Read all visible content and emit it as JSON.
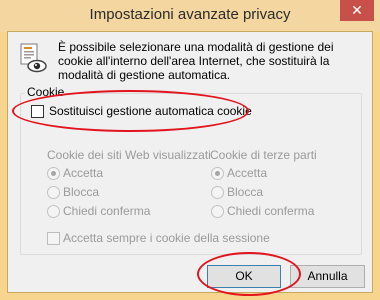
{
  "window": {
    "title": "Impostazioni avanzate privacy",
    "close_glyph": "✕",
    "close_icon": "close-icon",
    "info_icon": "privacy-document-eye-icon"
  },
  "info_text": "È possibile selezionare una modalità di gestione dei cookie all'interno dell'area Internet, che sostituirà la modalità di gestione automatica.",
  "cookie_group": {
    "legend": "Cookie",
    "override_label": "Sostituisci gestione automatica cookie",
    "override_checked": false,
    "first_party": {
      "header": "Cookie dei siti Web visualizzati",
      "options": [
        "Accetta",
        "Blocca",
        "Chiedi conferma"
      ],
      "selected": "Accetta"
    },
    "third_party": {
      "header": "Cookie di terze parti",
      "options": [
        "Accetta",
        "Blocca",
        "Chiedi conferma"
      ],
      "selected": "Accetta"
    },
    "session_label": "Accetta sempre i cookie della sessione",
    "session_checked": false
  },
  "buttons": {
    "ok": "OK",
    "cancel": "Annulla"
  },
  "colors": {
    "title_bar": "#f4d6a0",
    "close_button": "#c7504a",
    "annotation": "#e2141e"
  }
}
